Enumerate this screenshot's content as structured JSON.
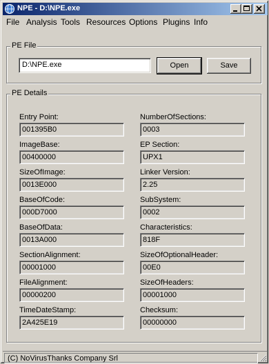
{
  "window": {
    "title": "NPE - D:\\NPE.exe",
    "icon": "app-globe-icon"
  },
  "menu": [
    {
      "label": "File"
    },
    {
      "label": "Analysis"
    },
    {
      "label": "Tools"
    },
    {
      "label": "Resources"
    },
    {
      "label": "Options"
    },
    {
      "label": "Plugins"
    },
    {
      "label": "Info"
    }
  ],
  "pe_file": {
    "group_label": "PE File",
    "path_value": "D:\\NPE.exe",
    "open_label": "Open",
    "save_label": "Save"
  },
  "pe_details": {
    "group_label": "PE Details",
    "left": [
      {
        "label": "Entry Point:",
        "value": "001395B0"
      },
      {
        "label": "ImageBase:",
        "value": "00400000"
      },
      {
        "label": "SizeOfImage:",
        "value": "0013E000"
      },
      {
        "label": "BaseOfCode:",
        "value": "000D7000"
      },
      {
        "label": "BaseOfData:",
        "value": "0013A000"
      },
      {
        "label": "SectionAlignment:",
        "value": "00001000"
      },
      {
        "label": "FileAlignment:",
        "value": "00000200"
      },
      {
        "label": "TimeDateStamp:",
        "value": "2A425E19"
      }
    ],
    "right": [
      {
        "label": "NumberOfSections:",
        "value": "0003"
      },
      {
        "label": "EP Section:",
        "value": "UPX1"
      },
      {
        "label": "Linker Version:",
        "value": "2.25"
      },
      {
        "label": "SubSystem:",
        "value": "0002"
      },
      {
        "label": "Characteristics:",
        "value": "818F"
      },
      {
        "label": "SizeOfOptionalHeader:",
        "value": "00E0"
      },
      {
        "label": "SizeOfHeaders:",
        "value": "00001000"
      },
      {
        "label": "Checksum:",
        "value": "00000000"
      }
    ]
  },
  "status": {
    "text": "(C) NoVirusThanks Company Srl"
  }
}
